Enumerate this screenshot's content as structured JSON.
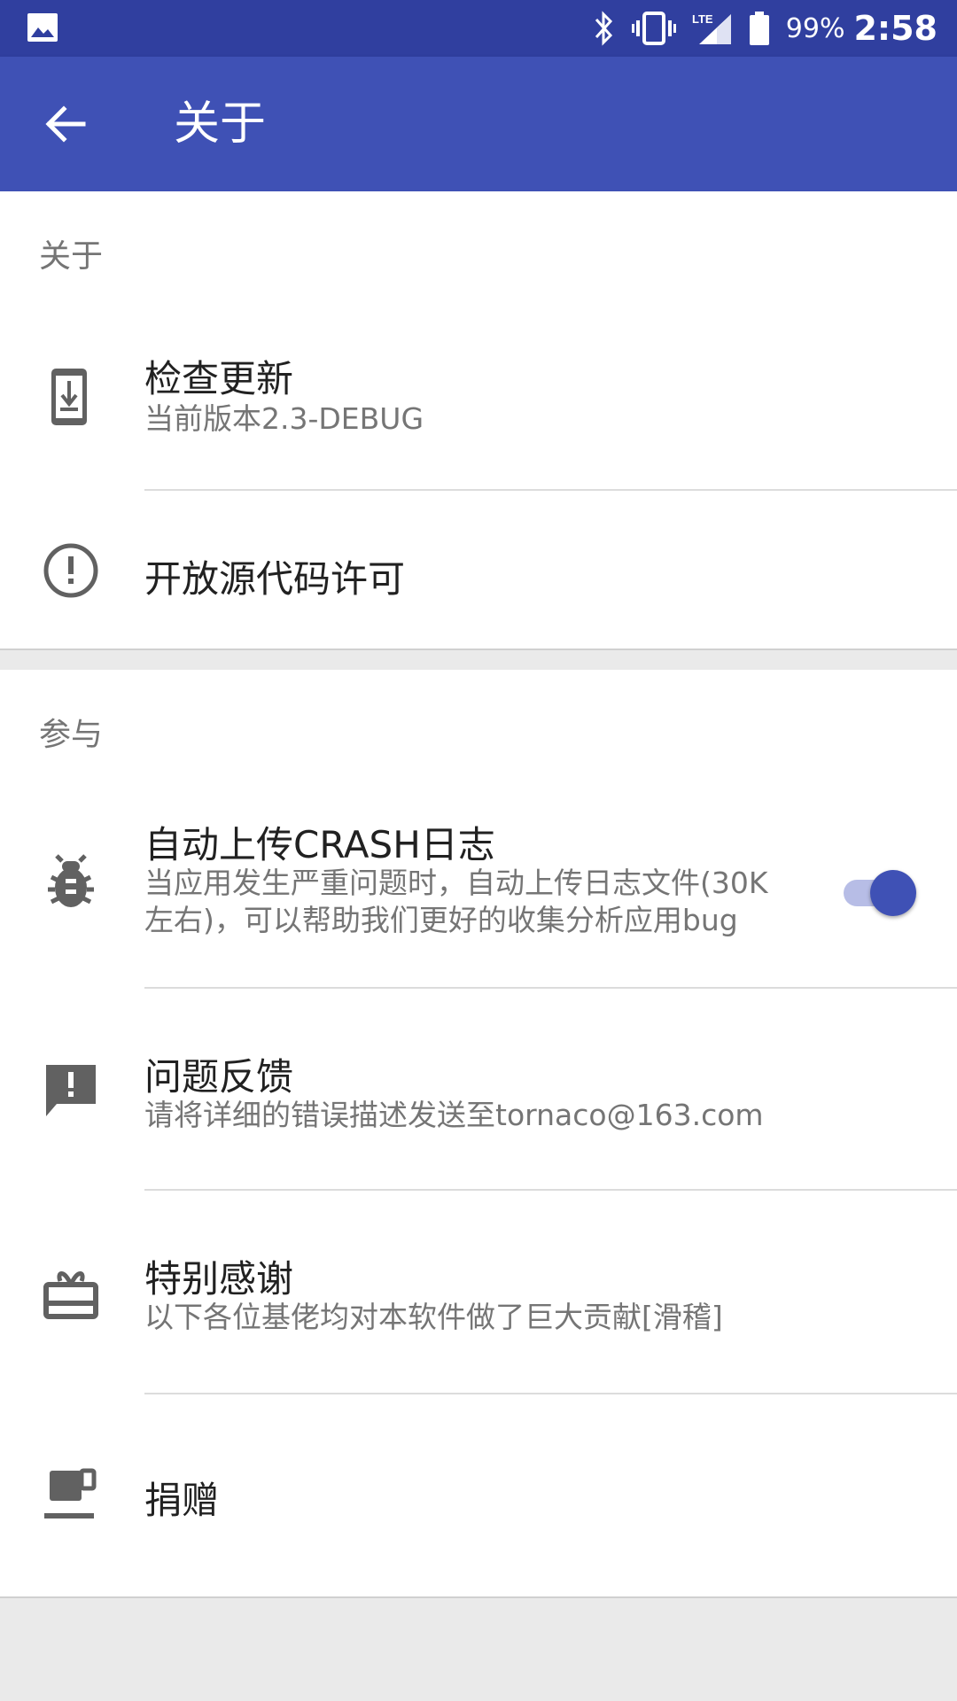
{
  "status_bar": {
    "battery_percent": "99%",
    "time": "2:58",
    "network": "LTE",
    "icons": [
      "image-icon",
      "bluetooth-icon",
      "vibrate-icon",
      "lte-signal-icon",
      "battery-icon"
    ]
  },
  "app_bar": {
    "title": "关于",
    "back_icon": "arrow-back-icon"
  },
  "sections": {
    "about": {
      "header": "关于",
      "items": [
        {
          "title": "检查更新",
          "summary": "当前版本2.3-DEBUG",
          "icon": "system-update-icon"
        },
        {
          "title": "开放源代码许可",
          "icon": "error-outline-icon"
        }
      ]
    },
    "participate": {
      "header": "参与",
      "items": [
        {
          "title": "自动上传CRASH日志",
          "summary": "当应用发生严重问题时，自动上传日志文件(30K左右)，可以帮助我们更好的收集分析应用bug",
          "icon": "bug-icon",
          "toggle_on": true
        },
        {
          "title": "问题反馈",
          "summary": "请将详细的错误描述发送至tornaco@163.com",
          "icon": "feedback-icon"
        },
        {
          "title": "特别感谢",
          "summary": "以下各位基佬均对本软件做了巨大贡献[滑稽]",
          "icon": "cake-icon"
        },
        {
          "title": "捐赠",
          "icon": "coffee-icon"
        }
      ]
    }
  },
  "colors": {
    "primary": "#3f51b5",
    "primary_dark": "#303f9f",
    "accent_track": "#b7bde6"
  }
}
